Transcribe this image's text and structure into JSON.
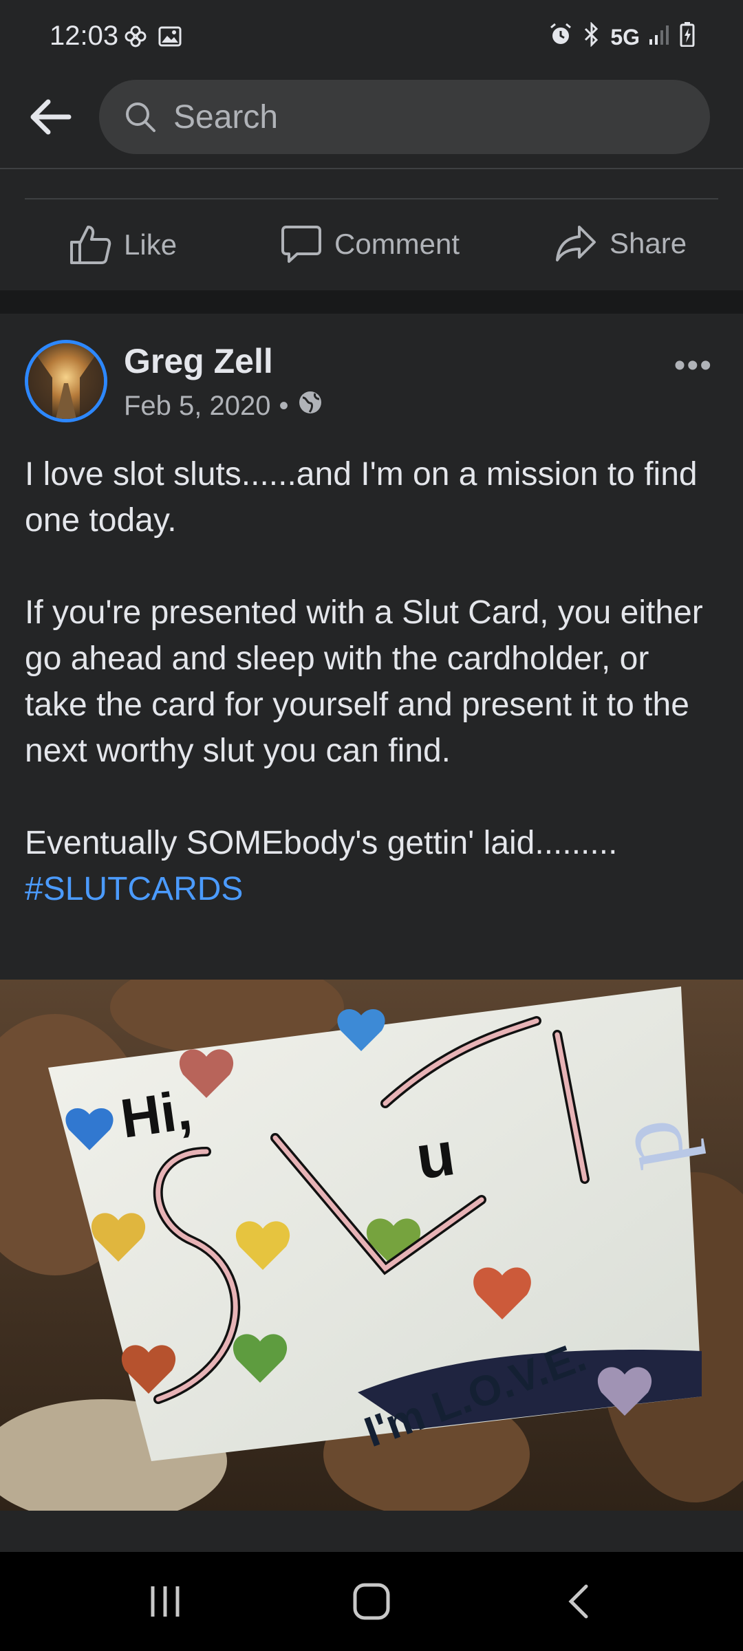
{
  "status_bar": {
    "time": "12:03",
    "network": "5G",
    "icons": [
      "pinwheel-icon",
      "gallery-icon",
      "alarm-icon",
      "bluetooth-icon",
      "signal-icon",
      "battery-charging-icon"
    ]
  },
  "header": {
    "search_placeholder": "Search"
  },
  "actions": {
    "like": "Like",
    "comment": "Comment",
    "share": "Share"
  },
  "post": {
    "author": "Greg Zell",
    "date": "Feb 5, 2020",
    "separator": "•",
    "more": "•••",
    "paragraphs": [
      "I love slot sluts......and I'm on a mission to find one today.",
      "If you're presented with a Slut Card, you either go ahead and sleep with the cardholder, or take the card for yourself and present it to the next worthy slut you can find."
    ],
    "last_line": "Eventually SOMEbody's gettin' laid.........",
    "hashtag": "#SLUTCARDS",
    "image_text": {
      "hi": "Hi,",
      "u": "u",
      "love": "I'm L.O.V.E.",
      "signature": "d"
    }
  },
  "colors": {
    "background": "#242526",
    "accent": "#2d88ff",
    "hashtag": "#4b9bff"
  }
}
